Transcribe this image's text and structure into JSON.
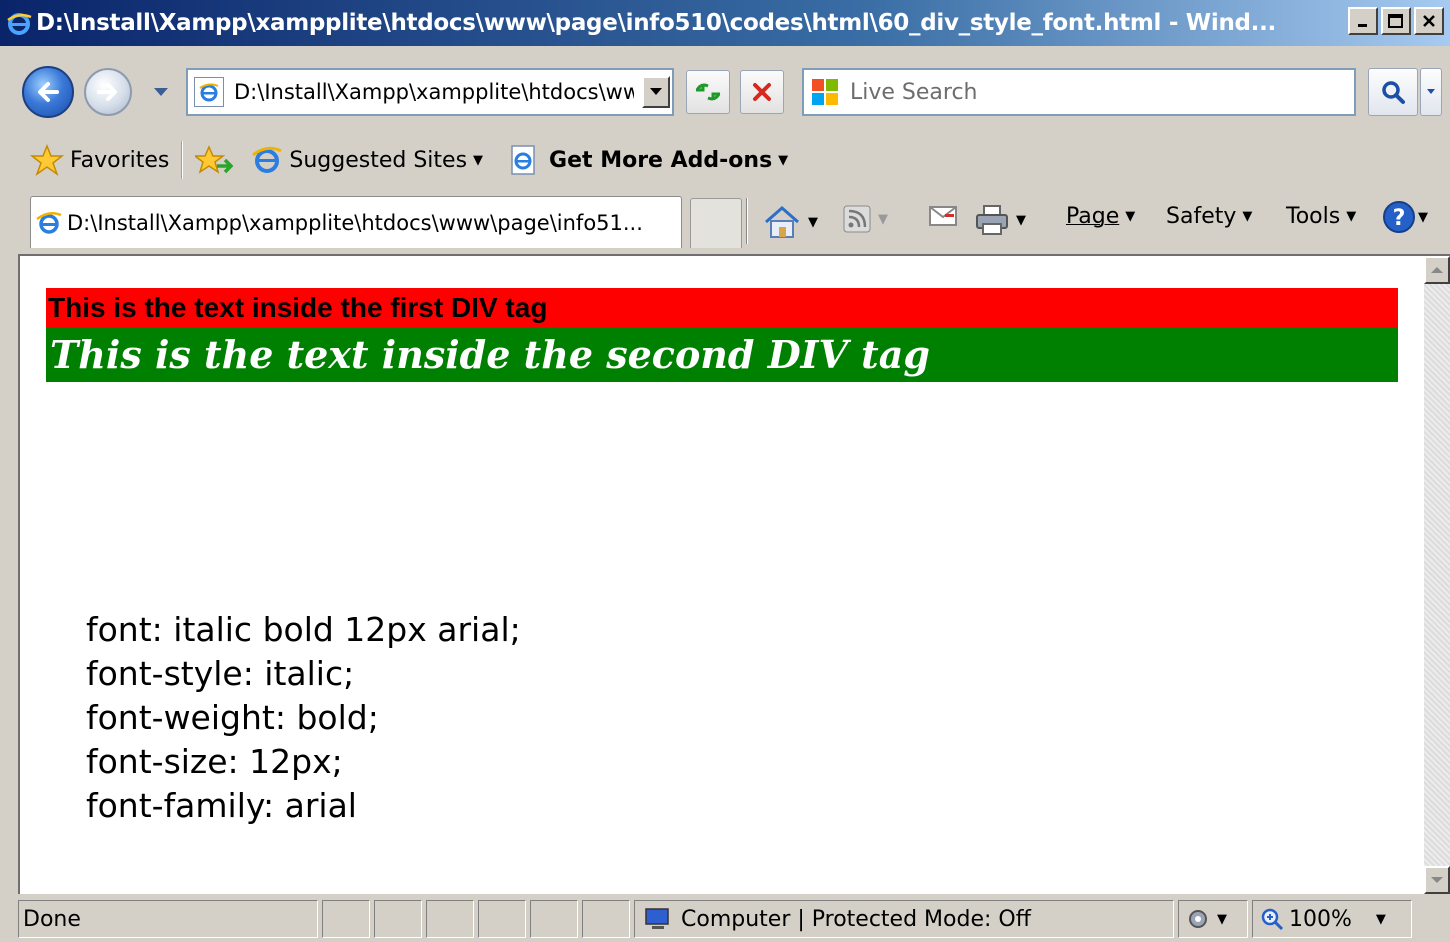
{
  "window": {
    "title": "D:\\Install\\Xampp\\xampplite\\htdocs\\www\\page\\info510\\codes\\html\\60_div_style_font.html - Wind...",
    "controls": [
      "minimize",
      "maximize",
      "close"
    ]
  },
  "nav": {
    "address": "D:\\Install\\Xampp\\xampplite\\htdocs\\ww",
    "search_placeholder": "Live Search"
  },
  "favorites": {
    "favorites_label": "Favorites",
    "suggested_label": "Suggested Sites",
    "addons_label": "Get More Add-ons"
  },
  "tab": {
    "title": "D:\\Install\\Xampp\\xampplite\\htdocs\\www\\page\\info51..."
  },
  "commands": {
    "page": "Page",
    "safety": "Safety",
    "tools": "Tools"
  },
  "content": {
    "div1_text": "This is the text inside the first DIV tag",
    "div2_text": "This is the text inside the second DIV tag",
    "div1_bg": "#ff0000",
    "div2_bg": "#008000",
    "notes": [
      "font: italic bold 12px arial;",
      "font-style: italic;",
      "font-weight: bold;",
      "font-size: 12px;",
      "font-family: arial"
    ]
  },
  "status": {
    "left": "Done",
    "zone": "Computer | Protected Mode: Off",
    "zoom": "100%"
  },
  "icons": [
    "ie-icon",
    "back-icon",
    "forward-icon",
    "refresh-icon",
    "stop-icon",
    "search-icon",
    "favorites-star-icon",
    "home-icon",
    "feed-icon",
    "mail-icon",
    "print-icon",
    "help-icon",
    "computer-icon",
    "zoom-icon"
  ]
}
